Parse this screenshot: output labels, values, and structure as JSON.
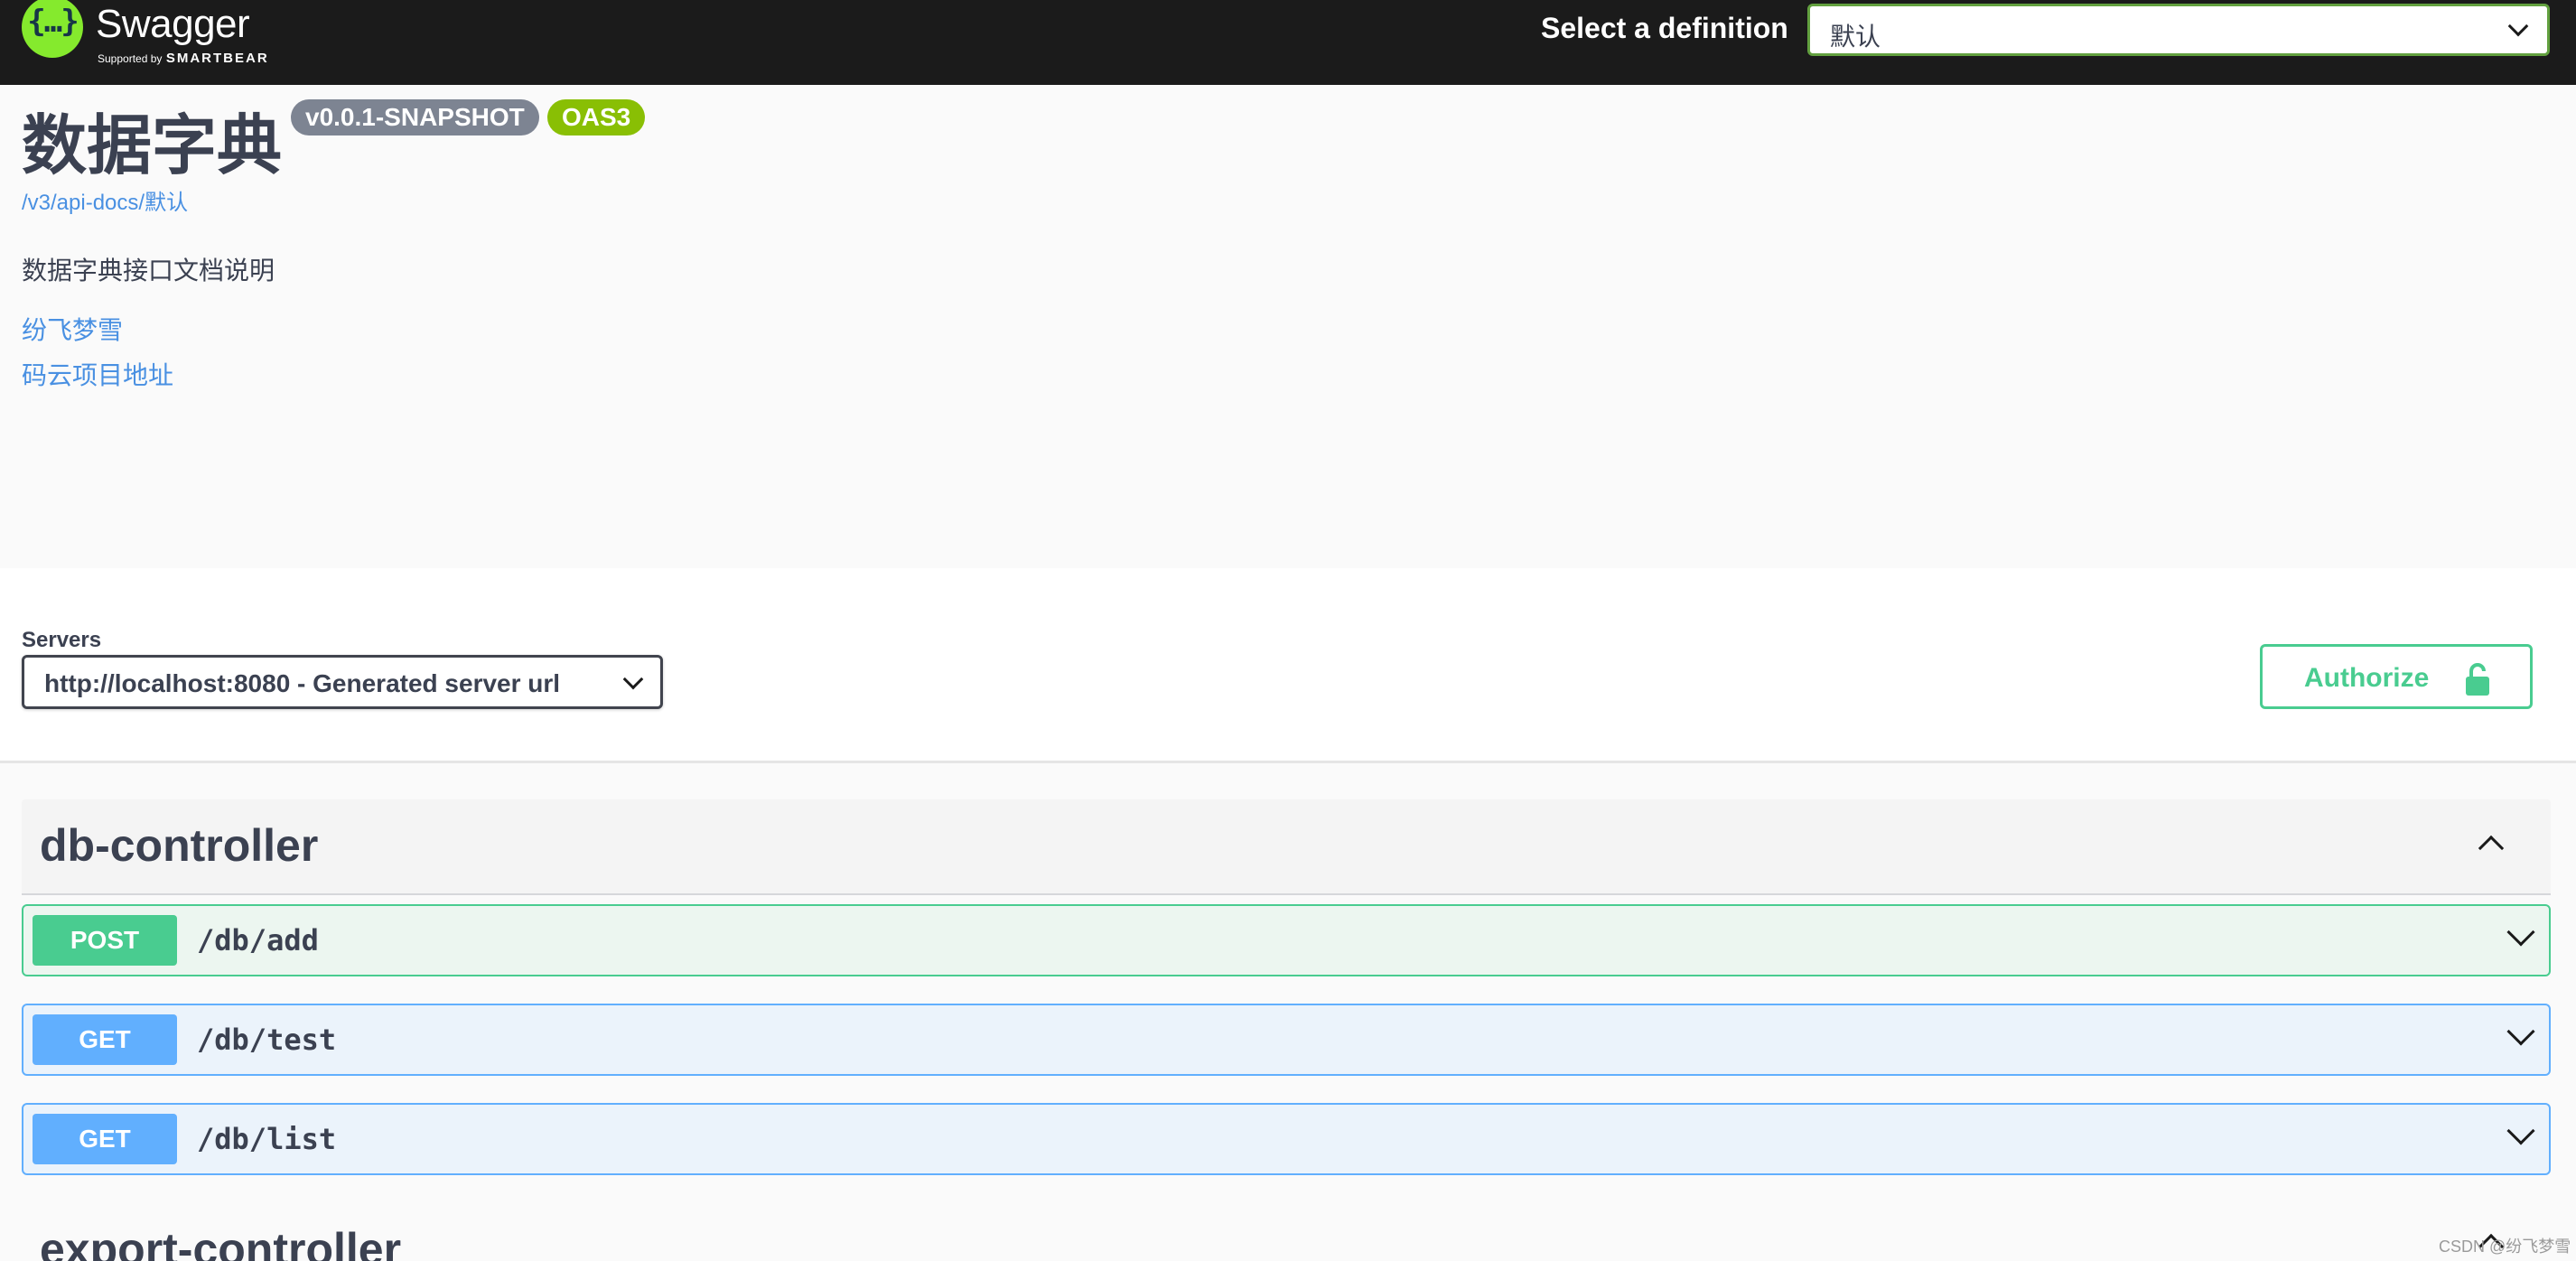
{
  "topbar": {
    "logo_text": "Swagger",
    "logo_tm": ".",
    "logo_sub_small": "Supported by",
    "logo_sub_strong": "SMARTBEAR",
    "definition_label": "Select a definition",
    "definition_value": "默认"
  },
  "info": {
    "title": "数据字典",
    "version": "v0.0.1-SNAPSHOT",
    "oas": "OAS3",
    "docs_url": "/v3/api-docs/默认",
    "description": "数据字典接口文档说明",
    "contact_link": "纷飞梦雪",
    "repo_link": "码云项目地址"
  },
  "servers": {
    "label": "Servers",
    "selected": "http://localhost:8080 - Generated server url"
  },
  "authorize": {
    "label": "Authorize"
  },
  "tags": [
    {
      "name": "db-controller",
      "operations": [
        {
          "method": "POST",
          "path": "/db/add"
        },
        {
          "method": "GET",
          "path": "/db/test"
        },
        {
          "method": "GET",
          "path": "/db/list"
        }
      ]
    },
    {
      "name": "export-controller"
    }
  ],
  "watermark": "CSDN @纷飞梦雪",
  "colors": {
    "post": "#49cc90",
    "get": "#61affe",
    "logo": "#85ea2d",
    "select_border": "#62a03f"
  }
}
